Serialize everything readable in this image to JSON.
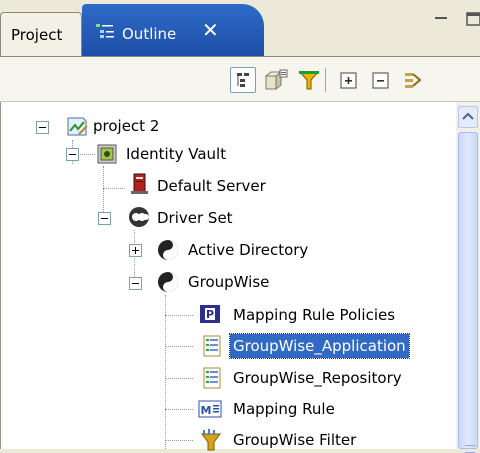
{
  "tabs": {
    "project_label": "Project",
    "outline_label": "Outline",
    "close_glyph": "✕"
  },
  "toolbar": {
    "buttons": [
      "hierarchy-icon",
      "show-properties-icon",
      "filter-icon",
      "expand-all-icon",
      "collapse-all-icon",
      "link-icon"
    ]
  },
  "tree": {
    "items": [
      {
        "label": "project 2",
        "icon": "project-icon",
        "expander": "minus"
      },
      {
        "label": "Identity Vault",
        "icon": "identity-vault-icon",
        "expander": "minus"
      },
      {
        "label": "Default Server",
        "icon": "server-icon",
        "expander": "none"
      },
      {
        "label": "Driver Set",
        "icon": "driver-set-icon",
        "expander": "minus"
      },
      {
        "label": "Active Directory",
        "icon": "driver-icon",
        "expander": "plus"
      },
      {
        "label": "GroupWise",
        "icon": "driver-icon",
        "expander": "minus"
      },
      {
        "label": "Mapping Rule Policies",
        "icon": "policy-icon",
        "expander": "none"
      },
      {
        "label": "GroupWise_Application",
        "icon": "object-icon",
        "expander": "none",
        "selected": true
      },
      {
        "label": "GroupWise_Repository",
        "icon": "object-icon",
        "expander": "none"
      },
      {
        "label": "Mapping Rule",
        "icon": "mapping-rule-icon",
        "expander": "none"
      },
      {
        "label": "GroupWise Filter",
        "icon": "filter-icon",
        "expander": "none"
      }
    ]
  },
  "colors": {
    "selection": "#316ac5",
    "active_tab": "#2f6ac8",
    "chrome": "#ece9d8"
  }
}
